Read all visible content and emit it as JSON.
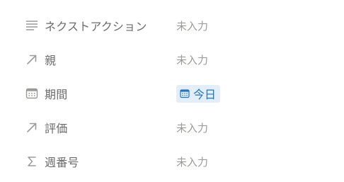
{
  "properties": [
    {
      "name": "ネクストアクション",
      "icon": "text-lines-icon",
      "value": "未入力"
    },
    {
      "name": "親",
      "icon": "relation-arrow-icon",
      "value": "未入力"
    },
    {
      "name": "期間",
      "icon": "calendar-icon",
      "value": "今日",
      "value_icon": "calendar-icon"
    },
    {
      "name": "評価",
      "icon": "relation-arrow-icon",
      "value": "未入力"
    },
    {
      "name": "週番号",
      "icon": "sigma-icon",
      "value": "未入力"
    }
  ],
  "colors": {
    "label": "#6b6b6b",
    "icon": "#9b9a97",
    "empty_value": "#9b9a97",
    "date_chip_bg": "#e3eef8",
    "date_chip_text": "#1d75c6"
  }
}
